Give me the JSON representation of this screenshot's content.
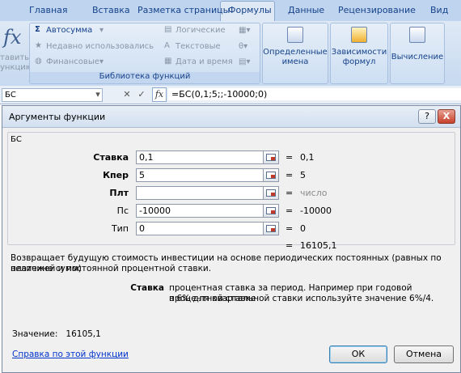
{
  "ribbon": {
    "tabs": [
      {
        "label": "Главная"
      },
      {
        "label": "Вставка"
      },
      {
        "label": "Разметка страницы"
      },
      {
        "label": "Формулы"
      },
      {
        "label": "Данные"
      },
      {
        "label": "Рецензирование"
      },
      {
        "label": "Вид"
      }
    ],
    "active_tab": "Формулы",
    "insert_function_label_1": "тавить",
    "insert_function_label_2": "ункцию",
    "library": {
      "autosum": "Автосумма",
      "recent": "Недавно использовались",
      "financial": "Финансовые",
      "logical": "Логические",
      "text": "Текстовые",
      "datetime": "Дата и время",
      "caption": "Библиотека функций"
    },
    "defined_names": {
      "line1": "Определенные",
      "line2": "имена"
    },
    "dependencies": {
      "line1": "Зависимости",
      "line2": "формул"
    },
    "calculation": {
      "line1": "Вычисление"
    }
  },
  "formula_bar": {
    "name_box": "БС",
    "cancel_icon": "✕",
    "enter_icon": "✓",
    "fx_icon": "fx",
    "formula": "=БС(0,1;5;;-10000;0)"
  },
  "dialog": {
    "title": "Аргументы функции",
    "help_btn": "?",
    "close_btn": "X",
    "function_name": "БС",
    "args": [
      {
        "label": "Ставка",
        "value": "0,1",
        "result": "0,1",
        "bold": true
      },
      {
        "label": "Кпер",
        "value": "5",
        "result": "5",
        "bold": true
      },
      {
        "label": "Плт",
        "value": "",
        "result": "число",
        "bold": true
      },
      {
        "label": "Пс",
        "value": "-10000",
        "result": "-10000",
        "bold": false
      },
      {
        "label": "Тип",
        "value": "0",
        "result": "0",
        "bold": false
      }
    ],
    "equals": "=",
    "total_result": "16105,1",
    "description_1": "Возвращает будущую стоимость инвестиции на основе периодических постоянных (равных по величине сумм)",
    "description_2": "платежей и постоянной процентной ставки.",
    "param_name": "Ставка",
    "param_desc_1": "процентная ставка за период. Например при годовой процентной ставке",
    "param_desc_2": "в 6% для квартальной ставки используйте значение 6%/4.",
    "value_label": "Значение:",
    "value": "16105,1",
    "help_link": "Справка по этой функции",
    "ok": "ОК",
    "cancel": "Отмена"
  }
}
